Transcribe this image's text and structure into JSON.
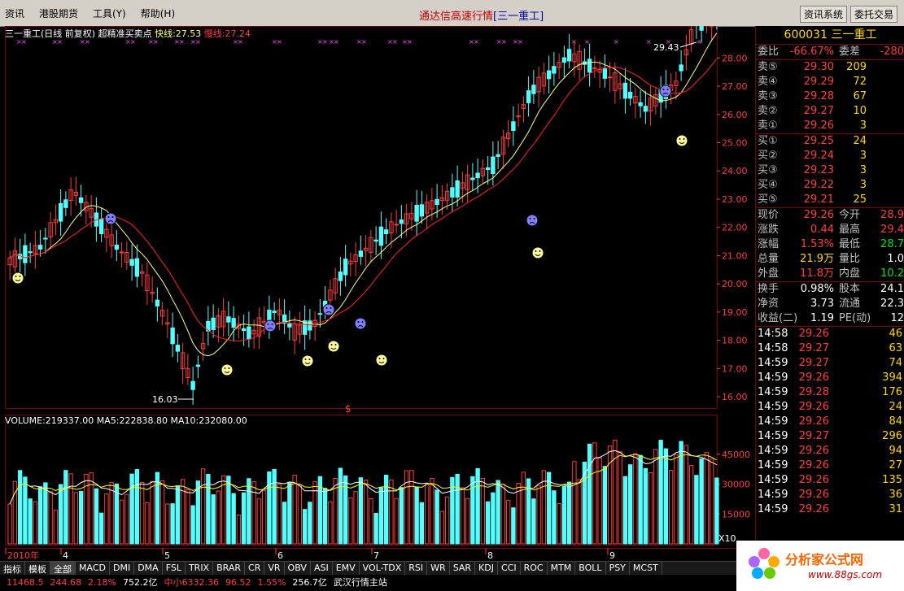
{
  "menu": {
    "items": [
      "资讯",
      "港股期货",
      "工具(Y)",
      "帮助(H)"
    ]
  },
  "window": {
    "title": "通达信高速行情",
    "title_bracket": "[三一重工]"
  },
  "top_buttons": [
    "资讯系统",
    "委托交易"
  ],
  "kline": {
    "header_name": "三一重工(日线 前复权)",
    "indicator": "超精准买卖点",
    "fast_label": "快线:27.53",
    "slow_label": "慢线:27.24",
    "high_label": "29.43",
    "low_label": "16.03"
  },
  "volume": {
    "header": "VOLUME:219337.00",
    "ma5": "MA5:222838.80",
    "ma10": "MA10:232080.00",
    "multiplier": "X10"
  },
  "chart_data": {
    "type": "candlestick",
    "price_ticks": [
      "28.00",
      "27.00",
      "26.00",
      "25.00",
      "24.00",
      "23.00",
      "22.00",
      "21.00",
      "20.00",
      "19.00",
      "18.00",
      "17.00",
      "16.00"
    ],
    "volume_ticks": [
      "45000",
      "30000",
      "15000"
    ],
    "x_labels": [
      "2010年",
      "4",
      "5",
      "6",
      "7",
      "8",
      "9"
    ],
    "price_range": [
      15.6,
      28.7
    ],
    "volume_range": [
      0,
      60000
    ],
    "series": [
      {
        "name": "快线",
        "last": 27.53
      },
      {
        "name": "慢线",
        "last": 27.24
      }
    ]
  },
  "quote": {
    "code_name": "600031 三一重工",
    "weibi": {
      "label": "委比",
      "value": "-66.67%",
      "label2": "委差",
      "value2": "-280"
    },
    "sell": [
      {
        "label": "卖⑤",
        "price": "29.30",
        "vol": "209"
      },
      {
        "label": "卖④",
        "price": "29.29",
        "vol": "72"
      },
      {
        "label": "卖③",
        "price": "29.28",
        "vol": "67"
      },
      {
        "label": "卖②",
        "price": "29.27",
        "vol": "10"
      },
      {
        "label": "卖①",
        "price": "29.26",
        "vol": "3"
      }
    ],
    "buy": [
      {
        "label": "买①",
        "price": "29.25",
        "vol": "24"
      },
      {
        "label": "买②",
        "price": "29.24",
        "vol": "3"
      },
      {
        "label": "买③",
        "price": "29.23",
        "vol": "3"
      },
      {
        "label": "买④",
        "price": "29.22",
        "vol": "3"
      },
      {
        "label": "买⑤",
        "price": "29.21",
        "vol": "25"
      }
    ],
    "stats": [
      {
        "l1": "现价",
        "v1": "29.26",
        "l2": "今开",
        "v2": "28.9"
      },
      {
        "l1": "涨跌",
        "v1": "0.44",
        "l2": "最高",
        "v2": "29.4"
      },
      {
        "l1": "涨幅",
        "v1": "1.53%",
        "l2": "最低",
        "v2": "28.7"
      },
      {
        "l1": "总量",
        "v1": "21.9万",
        "l2": "量比",
        "v2": "1.0"
      },
      {
        "l1": "外盘",
        "v1": "11.8万",
        "l2": "内盘",
        "v2": "10.2"
      }
    ],
    "fin": [
      {
        "l1": "换手",
        "v1": "0.98%",
        "l2": "股本",
        "v2": "24.1"
      },
      {
        "l1": "净资",
        "v1": "3.73",
        "l2": "流通",
        "v2": "22.3"
      },
      {
        "l1": "收益(二)",
        "v1": "1.19",
        "l2": "PE(动)",
        "v2": "12"
      }
    ],
    "ticks": [
      {
        "time": "14:58",
        "price": "29.26",
        "vol": "46"
      },
      {
        "time": "14:58",
        "price": "29.27",
        "vol": "63"
      },
      {
        "time": "14:59",
        "price": "29.27",
        "vol": "74"
      },
      {
        "time": "14:59",
        "price": "29.26",
        "vol": "394"
      },
      {
        "time": "14:59",
        "price": "29.28",
        "vol": "176"
      },
      {
        "time": "14:59",
        "price": "29.26",
        "vol": "24"
      },
      {
        "time": "14:59",
        "price": "29.26",
        "vol": "84"
      },
      {
        "time": "14:59",
        "price": "29.27",
        "vol": "296"
      },
      {
        "time": "14:59",
        "price": "29.26",
        "vol": "94"
      },
      {
        "time": "14:59",
        "price": "29.26",
        "vol": "27"
      },
      {
        "time": "14:59",
        "price": "29.26",
        "vol": "135"
      },
      {
        "time": "14:59",
        "price": "29.26",
        "vol": "36"
      },
      {
        "time": "14:59",
        "price": "29.26",
        "vol": "31"
      }
    ]
  },
  "tabs": [
    "指标",
    "模板",
    "全部",
    "MACD",
    "DMI",
    "DMA",
    "FSL",
    "TRIX",
    "BRAR",
    "CR",
    "VR",
    "OBV",
    "ASI",
    "EMV",
    "VOL-TDX",
    "RSI",
    "WR",
    "SAR",
    "KDJ",
    "CCI",
    "ROC",
    "MTM",
    "BOLL",
    "PSY",
    "MCST"
  ],
  "status": [
    "11468.5",
    "244.68",
    "2.18%",
    "752.2亿",
    "中小6332.36",
    "96.52",
    "1.55%",
    "256.7亿",
    "武汉行情主站"
  ],
  "logo": {
    "title": "分析家公式网",
    "url": "www.88gs.com"
  },
  "colors": {
    "up": "#ff3c3c",
    "down": "#54ffff",
    "fast": "#ffff80",
    "slow": "#ff2020"
  }
}
